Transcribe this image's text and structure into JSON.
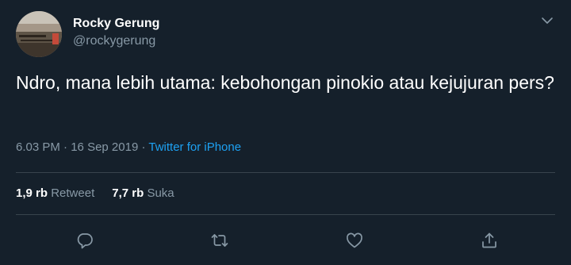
{
  "author": {
    "name": "Rocky Gerung",
    "handle": "@rockygerung"
  },
  "tweet": {
    "text": "Ndro, mana lebih utama: kebohongan pinokio atau kejujuran pers?",
    "time": "6.03 PM",
    "separator1": " · ",
    "date": "16 Sep 2019",
    "separator2": " · ",
    "source": "Twitter for iPhone"
  },
  "stats": {
    "retweets_count": "1,9 rb",
    "retweets_label": "Retweet",
    "likes_count": "7,7 rb",
    "likes_label": "Suka"
  },
  "icons": {
    "caret": "chevron-down-icon",
    "reply": "reply-icon",
    "retweet": "retweet-icon",
    "like": "heart-icon",
    "share": "share-icon"
  },
  "colors": {
    "background": "#15202b",
    "text": "#ffffff",
    "secondary": "#8899a6",
    "accent": "#1da1f2",
    "divider": "#38444d"
  }
}
